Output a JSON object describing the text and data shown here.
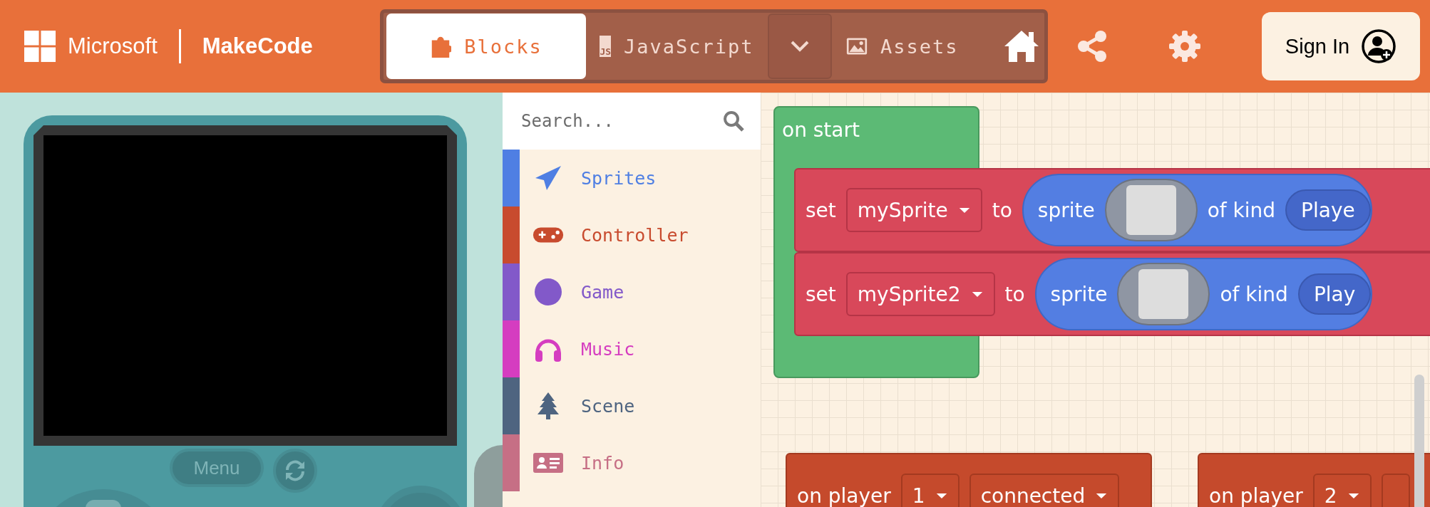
{
  "header": {
    "brand": "Microsoft",
    "product": "MakeCode",
    "tabs": [
      {
        "label": "Blocks",
        "kind": "blocks",
        "selected": true
      },
      {
        "label": "JavaScript",
        "kind": "js",
        "badge": "JS",
        "selected": false
      },
      {
        "label": "Assets",
        "kind": "assets",
        "selected": false
      }
    ],
    "sign_in": "Sign In"
  },
  "simulator": {
    "menu": "Menu"
  },
  "toolbox": {
    "search": {
      "placeholder": "Search..."
    },
    "categories": [
      {
        "label": "Sprites",
        "kind": "plane",
        "color": "#4f7fe3"
      },
      {
        "label": "Controller",
        "kind": "gamepad",
        "color": "#c84b2e"
      },
      {
        "label": "Game",
        "kind": "circle",
        "color": "#8259c9"
      },
      {
        "label": "Music",
        "kind": "headphones",
        "color": "#d53dc0"
      },
      {
        "label": "Scene",
        "kind": "tree",
        "color": "#4e6480"
      },
      {
        "label": "Info",
        "kind": "card",
        "color": "#c66f85"
      }
    ]
  },
  "workspace": {
    "on_start": {
      "label": "on start",
      "statements": [
        {
          "set": "set",
          "variable": "mySprite",
          "to": "to",
          "value": {
            "label": "sprite",
            "of_kind": "of kind",
            "kind_value": "Playe"
          }
        },
        {
          "set": "set",
          "variable": "mySprite2",
          "to": "to",
          "value": {
            "label": "sprite",
            "of_kind": "of kind",
            "kind_value": "Play"
          }
        }
      ]
    },
    "player_events": [
      {
        "label": "on player",
        "player": "1",
        "event": "connected"
      },
      {
        "label": "on player",
        "player": "2"
      }
    ]
  }
}
